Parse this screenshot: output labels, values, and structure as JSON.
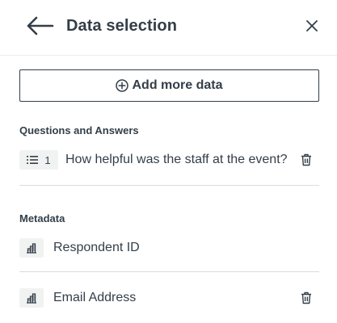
{
  "header": {
    "title": "Data selection",
    "back_icon": "arrow-left-icon",
    "close_icon": "close-icon"
  },
  "actions": {
    "add_more_data_label": "Add more data",
    "add_icon": "plus-circle-icon"
  },
  "questions_section": {
    "heading": "Questions and Answers",
    "items": [
      {
        "badge_icon": "list-icon",
        "number": "1",
        "label": "How helpful was the staff at the event?",
        "delete_icon": "trash-icon"
      }
    ]
  },
  "metadata_section": {
    "heading": "Metadata",
    "items": [
      {
        "badge_icon": "building-icon",
        "label": "Respondent ID"
      },
      {
        "badge_icon": "building-icon",
        "label": "Email Address",
        "delete_icon": "trash-icon"
      }
    ]
  },
  "colors": {
    "text": "#333e48",
    "badge_bg": "#f1f2f2",
    "divider": "#d9dcdf"
  }
}
